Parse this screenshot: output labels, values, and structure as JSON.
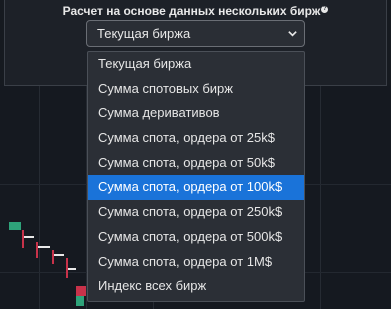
{
  "panel": {
    "title": "Расчет на основе данных нескольких бирж",
    "help_icon": "?"
  },
  "select": {
    "value": "Текущая биржа"
  },
  "dropdown": {
    "selected_index": 5,
    "options": [
      "Текущая биржа",
      "Сумма спотовых бирж",
      "Сумма деривативов",
      "Сумма спота, ордера от 25k$",
      "Сумма спота, ордера от 50k$",
      "Сумма спота, ордера от 100k$",
      "Сумма спота, ордера от 250k$",
      "Сумма спота, ордера от 500k$",
      "Сумма спота, ордера от 1M$",
      "Индекс всех бирж"
    ]
  },
  "colors": {
    "selected_option": "#1a73d9",
    "candle_up": "#2ea37a",
    "candle_down": "#c8324a"
  }
}
